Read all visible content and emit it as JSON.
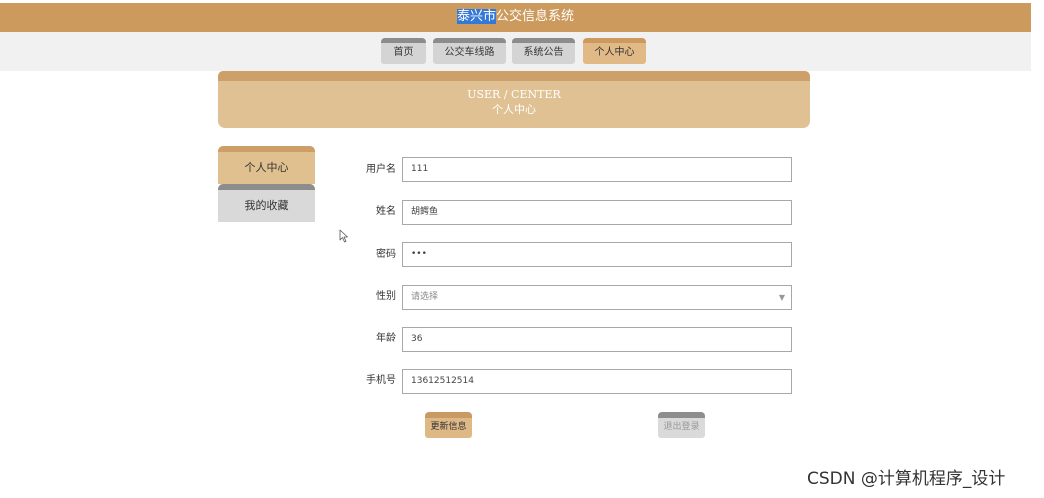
{
  "header": {
    "title_highlighted": "泰兴市",
    "title_rest": "公交信息系统"
  },
  "nav": {
    "tabs": [
      {
        "label": "首页"
      },
      {
        "label": "公交车线路"
      },
      {
        "label": "系统公告"
      },
      {
        "label": "个人中心"
      }
    ],
    "active_index": 3
  },
  "banner": {
    "title_en": "USER / CENTER",
    "title_cn": "个人中心"
  },
  "sidebar": {
    "items": [
      {
        "label": "个人中心"
      },
      {
        "label": "我的收藏"
      }
    ]
  },
  "form": {
    "username": {
      "label": "用户名",
      "value": "111"
    },
    "name": {
      "label": "姓名",
      "value": "胡鳄鱼"
    },
    "password": {
      "label": "密码",
      "value": "•••"
    },
    "gender": {
      "label": "性别",
      "placeholder": "请选择"
    },
    "age": {
      "label": "年龄",
      "value": "36"
    },
    "phone": {
      "label": "手机号",
      "value": "13612512514"
    }
  },
  "buttons": {
    "update": "更新信息",
    "logout": "退出登录"
  },
  "watermark": "CSDN @计算机程序_设计",
  "colors": {
    "accent": "#cd9a5e",
    "selection": "#3478d8",
    "tab_inactive": "#d4d4d4"
  }
}
